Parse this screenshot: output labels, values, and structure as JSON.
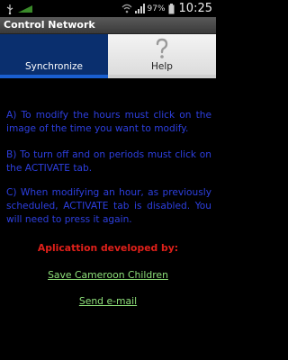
{
  "status_bar": {
    "icons": [
      "usb-icon",
      "signal-strength-icon",
      "wifi-icon",
      "mobile-signal-icon",
      "battery-icon"
    ],
    "battery_percent": "97%",
    "time": "10:25"
  },
  "app": {
    "title": "Control Network"
  },
  "tabs": [
    {
      "label": "Synchronize",
      "icon": "sync-icon",
      "selected": true
    },
    {
      "label": "Help",
      "icon": "help-icon",
      "selected": false
    }
  ],
  "help": {
    "paragraph_a": "A) To modify the hours must click on the image of the time you want to modify.",
    "paragraph_b": "B) To turn off and on periods must click on the ACTIVATE tab.",
    "paragraph_c": "C) When modifying an hour, as previously scheduled, ACTIVATE tab is disabled. You will need to press it again.",
    "developed_by": "Aplicattion developed by:",
    "organization_link": "Save Cameroon Children",
    "email_link": "Send e-mail"
  },
  "colors": {
    "help_text": "#2d3fe0",
    "developed_by": "#e0201a",
    "links": "#8ee07a",
    "selected_tab": "#0a2f6e",
    "tab_indicator": "#1a5fd0"
  }
}
